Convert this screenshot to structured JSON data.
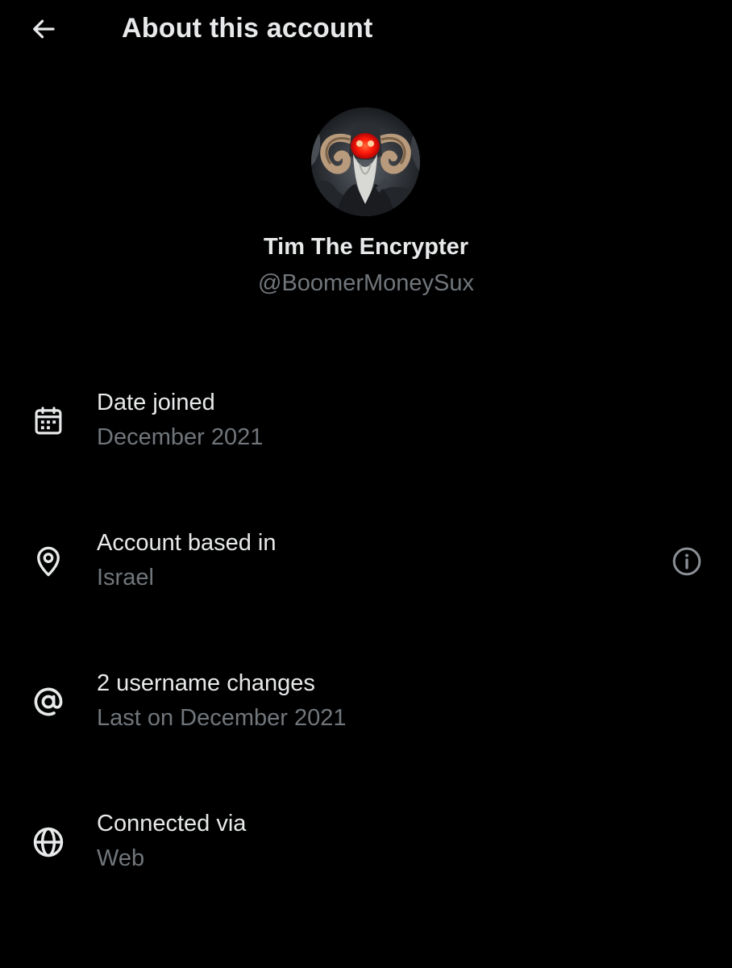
{
  "header": {
    "back_icon": "arrow-left-icon",
    "title": "About this account"
  },
  "profile": {
    "avatar_icon": "profile-avatar",
    "display_name": "Tim The Encrypter",
    "handle": "@BoomerMoneySux"
  },
  "details": [
    {
      "icon": "calendar-icon",
      "label": "Date joined",
      "value": "December 2021"
    },
    {
      "icon": "location-pin-icon",
      "label": "Account based in",
      "value": "Israel",
      "action_icon": "info-icon"
    },
    {
      "icon": "at-sign-icon",
      "label": "2 username changes",
      "value": "Last on December 2021"
    },
    {
      "icon": "globe-icon",
      "label": "Connected via",
      "value": "Web"
    }
  ],
  "colors": {
    "background": "#000000",
    "primary_text": "#e7e9ea",
    "secondary_text": "#71767b",
    "icon": "#e7e9ea"
  }
}
